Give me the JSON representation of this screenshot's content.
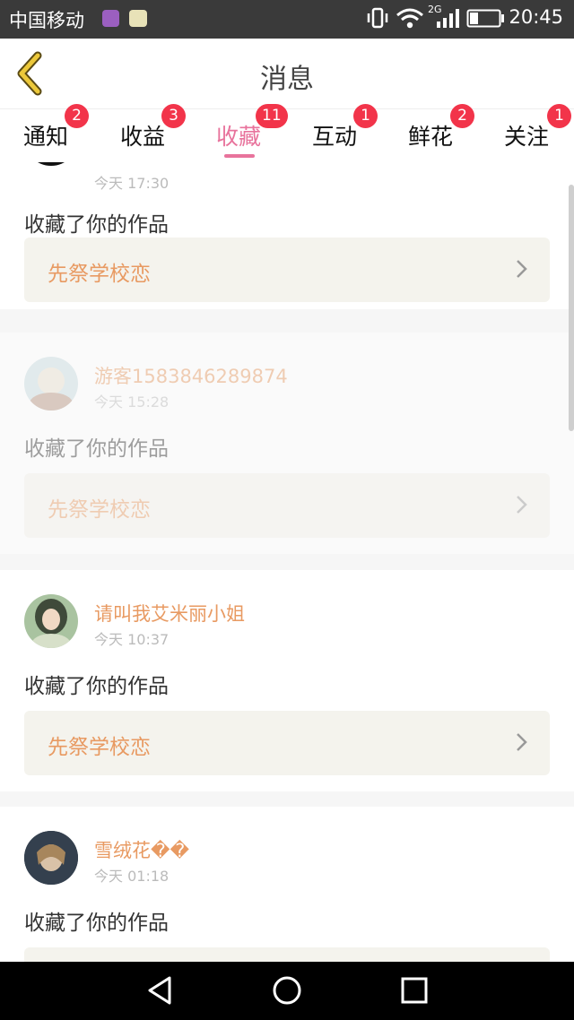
{
  "statusbar": {
    "carrier": "中国移动",
    "network": "2G",
    "time": "20:45"
  },
  "header": {
    "title": "消息"
  },
  "tabs": [
    {
      "label": "通知",
      "badge": "2"
    },
    {
      "label": "收益",
      "badge": "3"
    },
    {
      "label": "收藏",
      "badge": "11",
      "active": true
    },
    {
      "label": "互动",
      "badge": "1"
    },
    {
      "label": "鲜花",
      "badge": "2"
    },
    {
      "label": "关注",
      "badge": "1"
    }
  ],
  "items": [
    {
      "name": "",
      "time": "今天 17:30",
      "action": "收藏了你的作品",
      "work": "先祭学校恋"
    },
    {
      "name": "游客1583846289874",
      "time": "今天 15:28",
      "action": "收藏了你的作品",
      "work": "先祭学校恋"
    },
    {
      "name": "请叫我艾米丽小姐",
      "time": "今天 10:37",
      "action": "收藏了你的作品",
      "work": "先祭学校恋"
    },
    {
      "name": "雪绒花��",
      "time": "今天 01:18",
      "action": "收藏了你的作品",
      "work": ""
    }
  ],
  "colors": {
    "accent": "#e8739c",
    "badge": "#f2344a",
    "name": "#e89a62",
    "back": "#e8c53a"
  }
}
